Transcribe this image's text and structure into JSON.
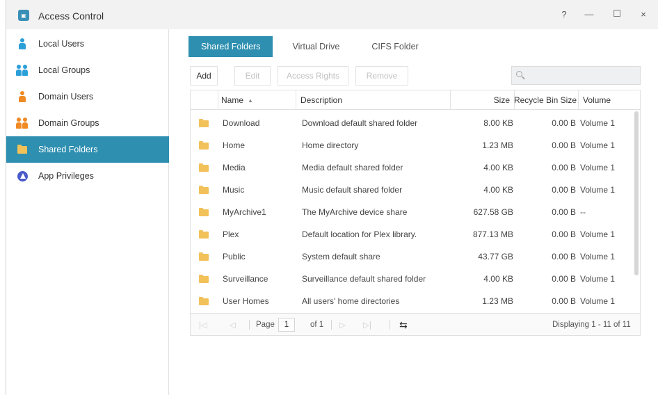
{
  "window": {
    "title": "Access Control",
    "controls": {
      "help": "?",
      "minimize": "—",
      "maximize": "☐",
      "close": "×"
    }
  },
  "sidebar": {
    "items": [
      {
        "label": "Local Users",
        "icon": "user-icon",
        "active": false
      },
      {
        "label": "Local Groups",
        "icon": "group-icon",
        "active": false
      },
      {
        "label": "Domain Users",
        "icon": "domain-user-icon",
        "active": false
      },
      {
        "label": "Domain Groups",
        "icon": "domain-group-icon",
        "active": false
      },
      {
        "label": "Shared Folders",
        "icon": "folder-icon",
        "active": true
      },
      {
        "label": "App Privileges",
        "icon": "app-privileges-icon",
        "active": false
      }
    ]
  },
  "tabs": [
    {
      "label": "Shared Folders",
      "active": true
    },
    {
      "label": "Virtual Drive",
      "active": false
    },
    {
      "label": "CIFS Folder",
      "active": false
    }
  ],
  "toolbar": {
    "add": "Add",
    "edit": "Edit",
    "access_rights": "Access Rights",
    "remove": "Remove",
    "search_placeholder": ""
  },
  "grid": {
    "columns": {
      "name": "Name",
      "sort_indicator": "▲",
      "description": "Description",
      "size": "Size",
      "recycle": "Recycle Bin Size",
      "volume": "Volume"
    },
    "rows": [
      {
        "name": "Download",
        "description": "Download default shared folder",
        "size": "8.00 KB",
        "recycle": "0.00 B",
        "volume": "Volume 1"
      },
      {
        "name": "Home",
        "description": "Home directory",
        "size": "1.23 MB",
        "recycle": "0.00 B",
        "volume": "Volume 1"
      },
      {
        "name": "Media",
        "description": "Media default shared folder",
        "size": "4.00 KB",
        "recycle": "0.00 B",
        "volume": "Volume 1"
      },
      {
        "name": "Music",
        "description": "Music default shared folder",
        "size": "4.00 KB",
        "recycle": "0.00 B",
        "volume": "Volume 1"
      },
      {
        "name": "MyArchive1",
        "description": "The MyArchive device share",
        "size": "627.58 GB",
        "recycle": "0.00 B",
        "volume": "--"
      },
      {
        "name": "Plex",
        "description": "Default location for Plex library.",
        "size": "877.13 MB",
        "recycle": "0.00 B",
        "volume": "Volume 1"
      },
      {
        "name": "Public",
        "description": "System default share",
        "size": "43.77 GB",
        "recycle": "0.00 B",
        "volume": "Volume 1"
      },
      {
        "name": "Surveillance",
        "description": "Surveillance default shared folder",
        "size": "4.00 KB",
        "recycle": "0.00 B",
        "volume": "Volume 1"
      },
      {
        "name": "User Homes",
        "description": "All users' home directories",
        "size": "1.23 MB",
        "recycle": "0.00 B",
        "volume": "Volume 1"
      }
    ]
  },
  "pager": {
    "first": "|◁",
    "prev": "◁",
    "page_label": "Page",
    "page_value": "1",
    "of_label": "of 1",
    "next": "▷",
    "last": "▷|",
    "refresh": "⇆",
    "displaying": "Displaying 1 - 11 of 11"
  },
  "colors": {
    "accent": "#2e8fb0",
    "folder": "#f2c15a",
    "user_blue": "#2b9fd8",
    "user_orange": "#f08a24",
    "app_icon": "#4a5bc9"
  }
}
